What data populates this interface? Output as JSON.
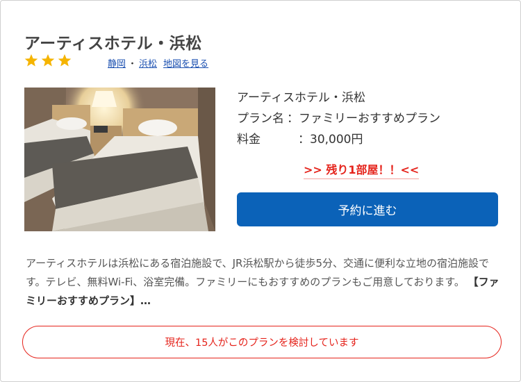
{
  "hotel": {
    "name": "アーティスホテル・浜松",
    "stars": 3,
    "star_color": "#f5b400",
    "location": {
      "prefecture": "静岡",
      "separator": "・",
      "city": "浜松",
      "map_link": "地図を見る"
    },
    "photo_icon": "hotel-room-photo"
  },
  "plan": {
    "hotel_name": "アーティスホテル・浜松",
    "plan_label": "プラン名",
    "plan_separator": "：",
    "plan_name": "ファミリーおすすめプラン",
    "price_label": "料金",
    "price_separator": "：",
    "price_value": "30,000円"
  },
  "availability": {
    "remaining_text": ">> 残り1部屋！！<<",
    "color": "#e5231b"
  },
  "reserve_button": {
    "label": "予約に進む",
    "color": "#0b62b8"
  },
  "description": {
    "text": "アーティスホテルは浜松にある宿泊施設で、JR浜松駅から徒歩5分、交通に便利な立地の宿泊施設です。テレビ、無料Wi-Fi、浴室完備。ファミリーにもおすすめのプランもご用意しております。",
    "highlight": "【ファミリーおすすめプラン】…"
  },
  "viewers_notice": {
    "text": "現在、15人がこのプランを検討しています"
  }
}
